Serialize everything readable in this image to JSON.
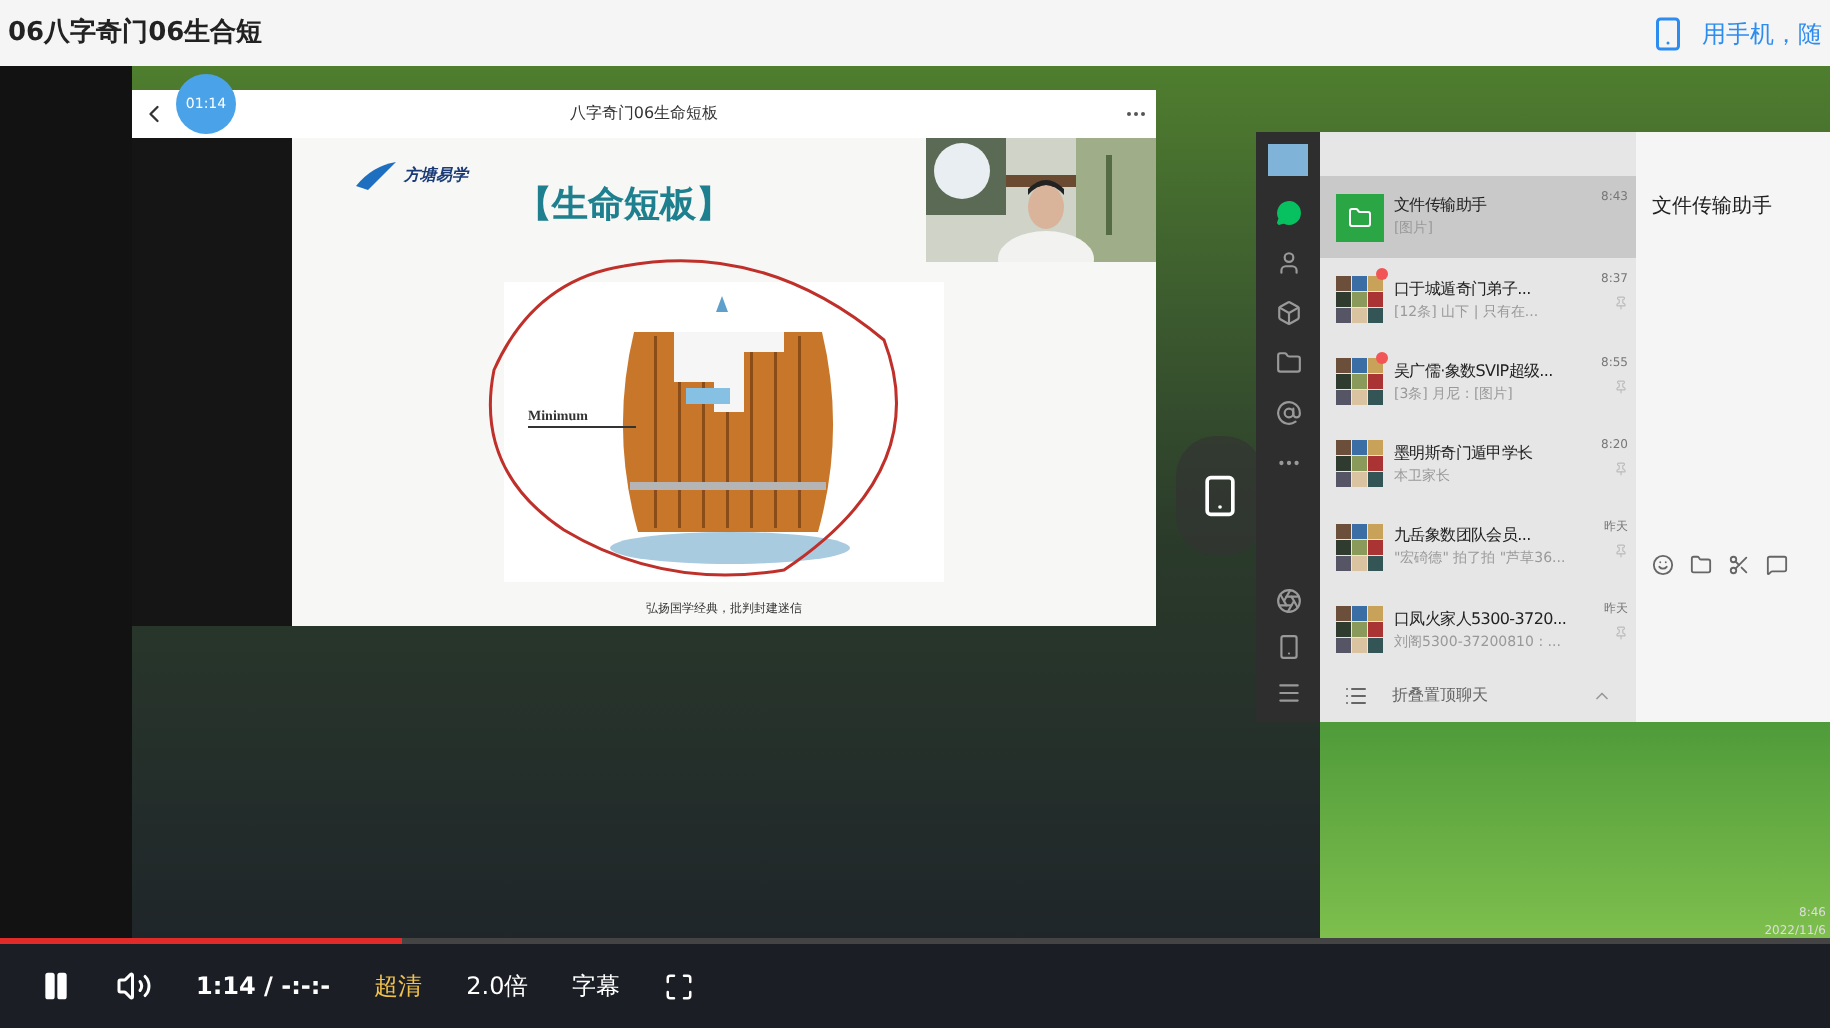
{
  "page": {
    "title": "06八字奇门06生合短",
    "mobile_link": "用手机，随"
  },
  "recording": {
    "timestamp_bubble": "01:14",
    "viewer": {
      "title": "八字奇门06生命短板"
    },
    "slide": {
      "logo_text": "方塘易学",
      "heading": "【生命短板】",
      "diagram_label": "Minimum",
      "caption": "弘扬国学经典，批判封建迷信"
    },
    "chat_app": {
      "chats": [
        {
          "name": "文件传输助手",
          "preview": "[图片]",
          "time": "8:43",
          "selected": true,
          "unread": false,
          "kind": "folder"
        },
        {
          "name": "口于城遁奇门弟子...",
          "preview": "[12条] 山下 | 只有在...",
          "time": "8:37",
          "selected": false,
          "unread": true,
          "kind": "group"
        },
        {
          "name": "吴广儒·象数SVIP超级...",
          "preview": "[3条] 月尼 : [图片]",
          "time": "8:55",
          "selected": false,
          "unread": true,
          "kind": "group"
        },
        {
          "name": "墨明斯奇门遁甲学长",
          "preview": "本卫家长",
          "time": "8:20",
          "selected": false,
          "unread": false,
          "kind": "group"
        },
        {
          "name": "九岳象数团队会员...",
          "preview": "\"宏碕德\" 拍了拍 \"芦草36...",
          "time": "昨天",
          "selected": false,
          "unread": false,
          "kind": "group"
        },
        {
          "name": "口凤火家人5300-3720...",
          "preview": "刘阁5300-37200810 : ...",
          "time": "昨天",
          "selected": false,
          "unread": false,
          "kind": "group"
        }
      ],
      "footer": "折叠置顶聊天",
      "open_chat_title": "文件传输助手"
    },
    "taskbar": {
      "clock": "8:46",
      "date": "2022/11/6"
    }
  },
  "player": {
    "playing": true,
    "progress": {
      "level": 0.22
    },
    "time": "1:14 / -:-:-",
    "quality": "超清",
    "speed": "2.0倍",
    "subtitles": "字幕"
  }
}
